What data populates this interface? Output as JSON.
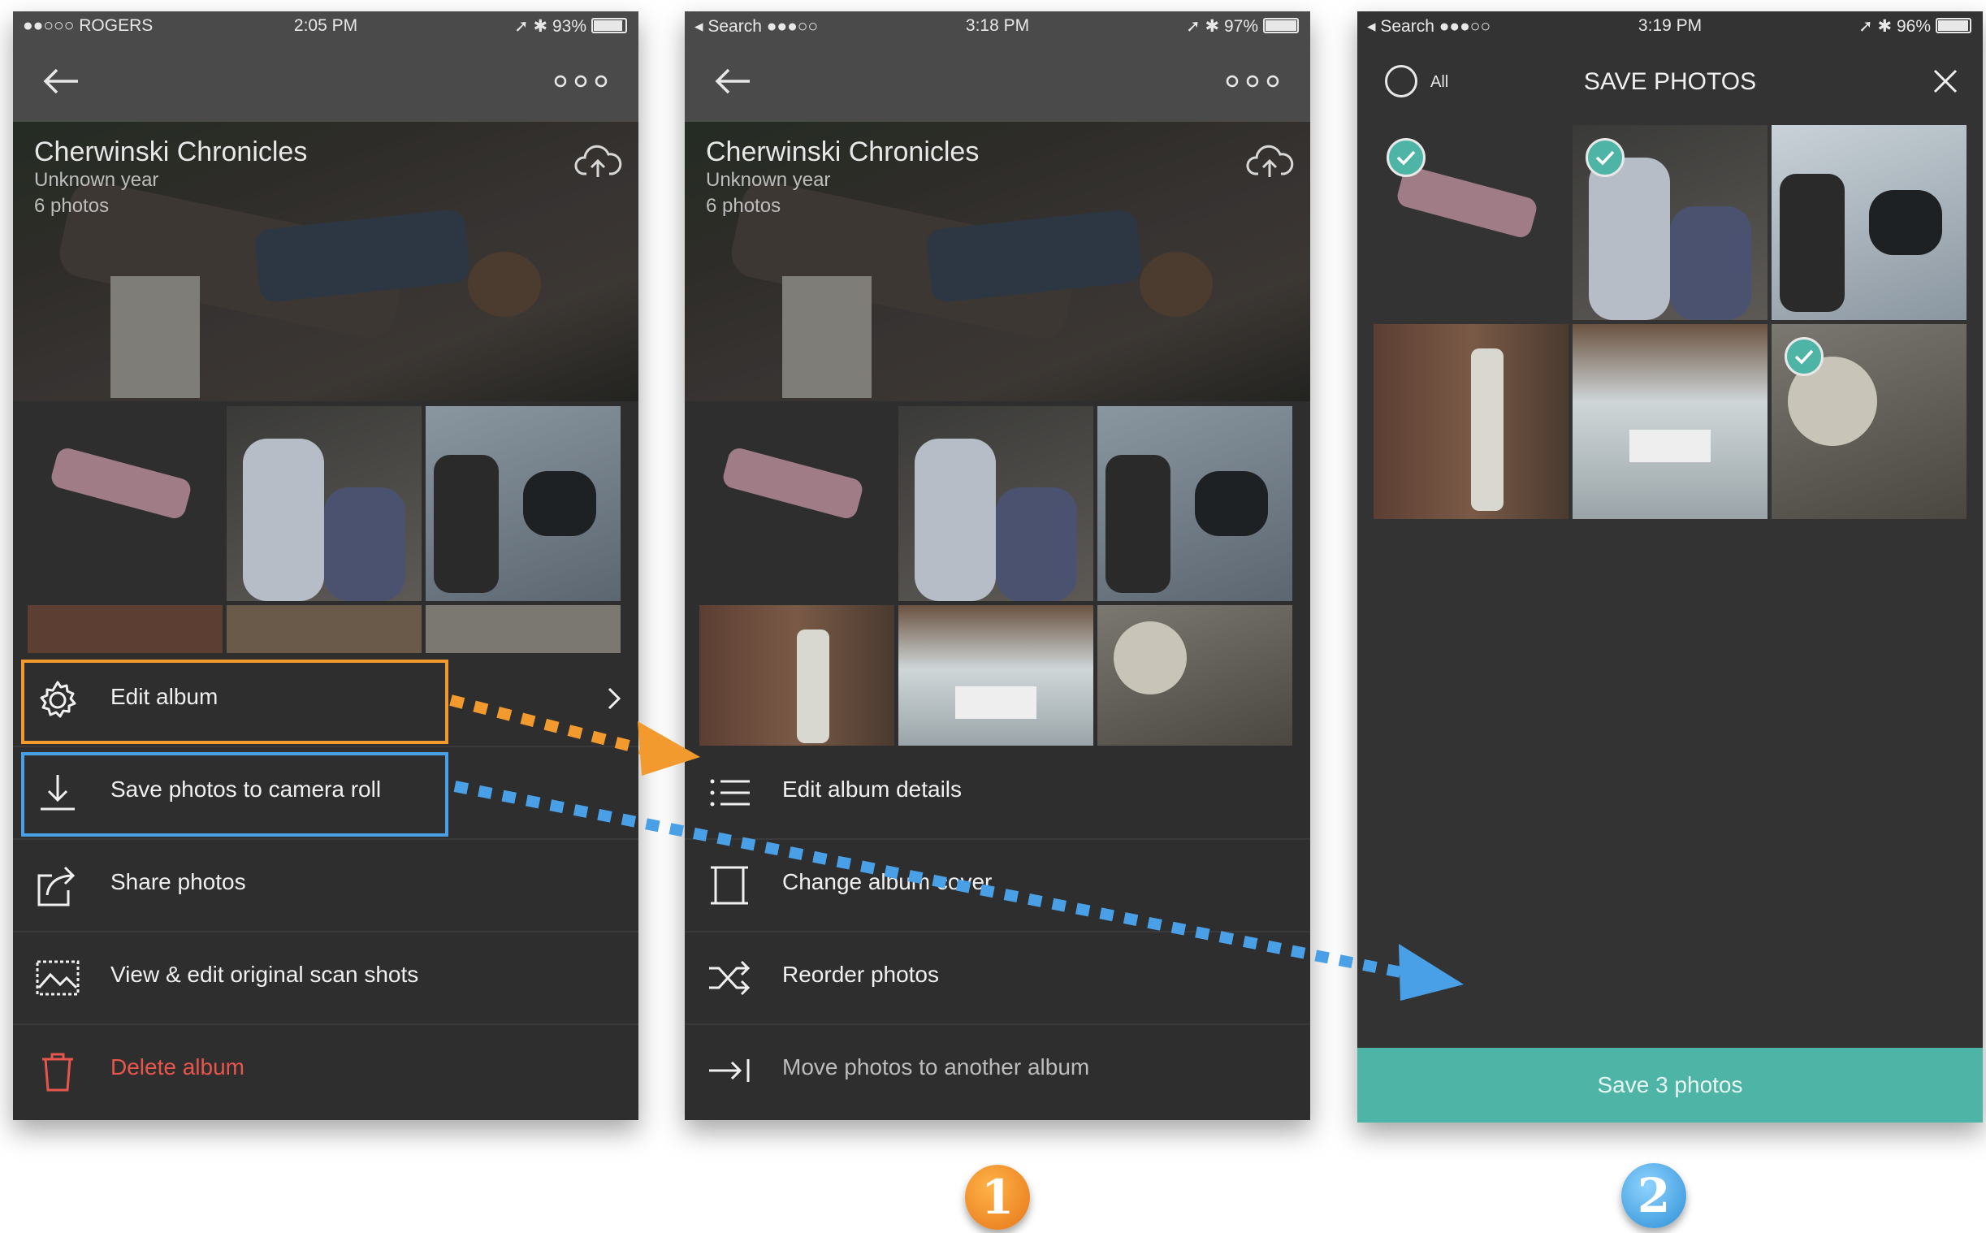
{
  "screen1": {
    "status": {
      "carrier": "●●○○○ ROGERS",
      "time": "2:05 PM",
      "battery": "93%"
    },
    "album": {
      "title": "Cherwinski Chronicles",
      "year": "Unknown year",
      "count": "6 photos"
    },
    "menu": [
      {
        "label": "Edit album",
        "icon": "gear-icon"
      },
      {
        "label": "Save photos to camera roll",
        "icon": "download-icon"
      },
      {
        "label": "Share photos",
        "icon": "share-icon"
      },
      {
        "label": "View & edit original scan shots",
        "icon": "image-scan-icon"
      },
      {
        "label": "Delete album",
        "icon": "trash-icon"
      }
    ]
  },
  "screen2": {
    "status": {
      "carrier": "◂ Search ●●●○○",
      "time": "3:18 PM",
      "battery": "97%"
    },
    "album": {
      "title": "Cherwinski Chronicles",
      "year": "Unknown year",
      "count": "6 photos"
    },
    "menu": [
      {
        "label": "Edit album details",
        "icon": "list-icon"
      },
      {
        "label": "Change album cover",
        "icon": "frame-icon"
      },
      {
        "label": "Reorder photos",
        "icon": "shuffle-icon"
      },
      {
        "label": "Move photos to another album",
        "icon": "move-icon"
      }
    ]
  },
  "screen3": {
    "status": {
      "carrier": "◂ Search ●●●○○",
      "time": "3:19 PM",
      "battery": "96%"
    },
    "all_label": "All",
    "title": "SAVE PHOTOS",
    "save_button": "Save 3 photos"
  },
  "badges": [
    "1",
    "2"
  ],
  "colors": {
    "highlight_orange": "#f29a2e",
    "highlight_blue": "#4aa0e6",
    "accent_teal": "#4eb4a5",
    "danger_red": "#e7564c"
  }
}
